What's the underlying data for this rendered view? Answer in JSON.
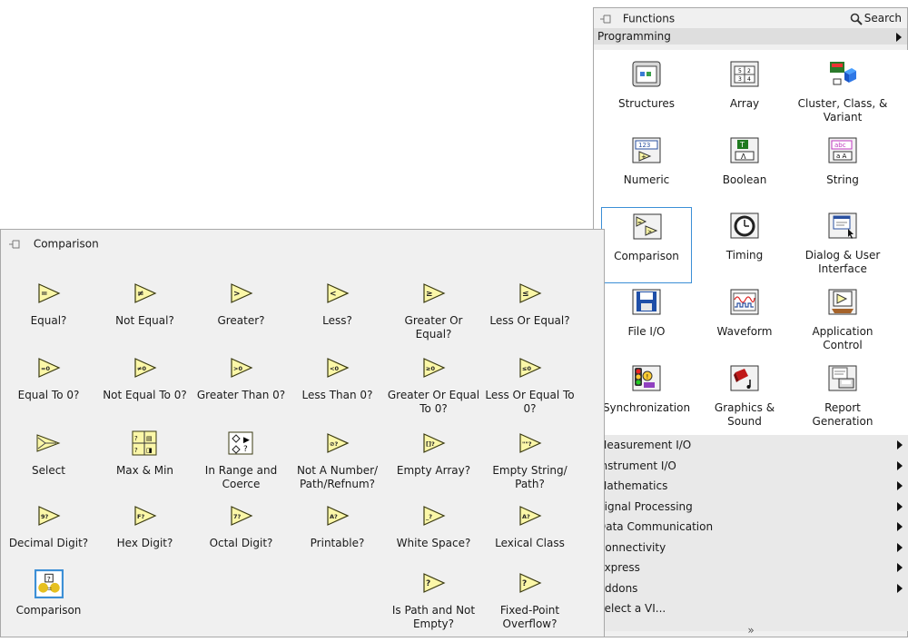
{
  "functions": {
    "title": "Functions",
    "search_label": "Search",
    "category": "Programming",
    "grid": [
      {
        "label": "Structures",
        "icon": "structures-icon"
      },
      {
        "label": "Array",
        "icon": "array-icon"
      },
      {
        "label": "Cluster, Class, & Variant",
        "icon": "cluster-icon"
      },
      {
        "label": "Numeric",
        "icon": "numeric-icon"
      },
      {
        "label": "Boolean",
        "icon": "boolean-icon"
      },
      {
        "label": "String",
        "icon": "string-icon"
      },
      {
        "label": "Comparison",
        "icon": "comparison-icon"
      },
      {
        "label": "Timing",
        "icon": "timing-icon"
      },
      {
        "label": "Dialog & User Interface",
        "icon": "dialog-icon"
      },
      {
        "label": "File I/O",
        "icon": "file-io-icon"
      },
      {
        "label": "Waveform",
        "icon": "waveform-icon"
      },
      {
        "label": "Application Control",
        "icon": "application-control-icon"
      },
      {
        "label": "Synchronization",
        "icon": "synchronization-icon"
      },
      {
        "label": "Graphics & Sound",
        "icon": "graphics-sound-icon"
      },
      {
        "label": "Report Generation",
        "icon": "report-generation-icon"
      }
    ],
    "subcategories": [
      "Measurement I/O",
      "Instrument I/O",
      "Mathematics",
      "Signal Processing",
      "Data Communication",
      "Connectivity",
      "Express",
      "Addons",
      "Select a VI..."
    ],
    "more_glyph": "»"
  },
  "comparison": {
    "title": "Comparison",
    "items": [
      {
        "label": "Equal?",
        "glyph": "="
      },
      {
        "label": "Not Equal?",
        "glyph": "≠"
      },
      {
        "label": "Greater?",
        "glyph": ">"
      },
      {
        "label": "Less?",
        "glyph": "<"
      },
      {
        "label": "Greater Or Equal?",
        "glyph": "≥"
      },
      {
        "label": "Less Or Equal?",
        "glyph": "≤"
      },
      {
        "label": "Equal To 0?",
        "glyph": "=0"
      },
      {
        "label": "Not Equal To 0?",
        "glyph": "≠0"
      },
      {
        "label": "Greater Than 0?",
        "glyph": ">0"
      },
      {
        "label": "Less Than 0?",
        "glyph": "<0"
      },
      {
        "label": "Greater Or Equal To 0?",
        "glyph": "≥0"
      },
      {
        "label": "Less Or Equal To 0?",
        "glyph": "≤0"
      },
      {
        "label": "Select",
        "glyph": ""
      },
      {
        "label": "Max & Min",
        "glyph": ""
      },
      {
        "label": "In Range and Coerce",
        "glyph": ""
      },
      {
        "label": "Not A Number/ Path/Refnum?",
        "glyph": "⊘?"
      },
      {
        "label": "Empty Array?",
        "glyph": "[]?"
      },
      {
        "label": "Empty String/ Path?",
        "glyph": "\"\"?"
      },
      {
        "label": "Decimal Digit?",
        "glyph": "9?"
      },
      {
        "label": "Hex Digit?",
        "glyph": "F?"
      },
      {
        "label": "Octal Digit?",
        "glyph": "7?"
      },
      {
        "label": "Printable?",
        "glyph": "A?"
      },
      {
        "label": "White Space?",
        "glyph": "_?"
      },
      {
        "label": "Lexical Class",
        "glyph": "A?"
      },
      {
        "label": "Comparison",
        "glyph": ""
      },
      {
        "label": "Is Path and Not Empty?",
        "glyph": "?"
      },
      {
        "label": "Fixed-Point Overflow?",
        "glyph": "?"
      }
    ]
  },
  "colors": {
    "comparison_icon_fill": "#fbf7a8",
    "comparison_icon_stroke": "#3a3a10",
    "selection_border": "#3c8fd6"
  }
}
